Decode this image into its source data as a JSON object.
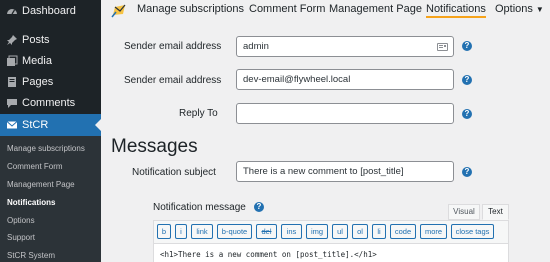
{
  "sidebar": {
    "items": [
      {
        "label": "Dashboard",
        "icon": "dashboard-icon"
      },
      {
        "label": "Posts",
        "icon": "pin-icon"
      },
      {
        "label": "Media",
        "icon": "media-icon"
      },
      {
        "label": "Pages",
        "icon": "pages-icon"
      },
      {
        "label": "Comments",
        "icon": "comments-icon"
      },
      {
        "label": "StCR",
        "icon": "email-icon"
      }
    ],
    "submenu": [
      "Manage subscriptions",
      "Comment Form",
      "Management Page",
      "Notifications",
      "Options",
      "Support",
      "StCR System"
    ]
  },
  "nav": {
    "links": [
      "Manage subscriptions",
      "Comment Form",
      "Management Page",
      "Notifications",
      "Options"
    ],
    "active": "Notifications",
    "accent": "#f6a31b"
  },
  "form": {
    "sender_name_label": "Sender email address",
    "sender_name_value": "admin",
    "sender_email_label": "Sender email address",
    "sender_email_value": "dev-email@flywheel.local",
    "reply_to_label": "Reply To",
    "reply_to_value": "",
    "messages_heading": "Messages",
    "subject_label": "Notification subject",
    "subject_value": "There is a new comment to [post_title]",
    "message_label": "Notification message",
    "help_glyph": "?"
  },
  "editor": {
    "tabs": [
      "Visual",
      "Text"
    ],
    "active_tab": "Text",
    "buttons": [
      "b",
      "i",
      "link",
      "b-quote",
      "del",
      "ins",
      "img",
      "ul",
      "ol",
      "li",
      "code",
      "more",
      "close tags"
    ],
    "content": "<h1>There is a new comment on [post_title].</h1>"
  },
  "colors": {
    "sidebar_bg": "#1d2327",
    "active_bg": "#2271b1",
    "help_blue": "#2271b1"
  }
}
